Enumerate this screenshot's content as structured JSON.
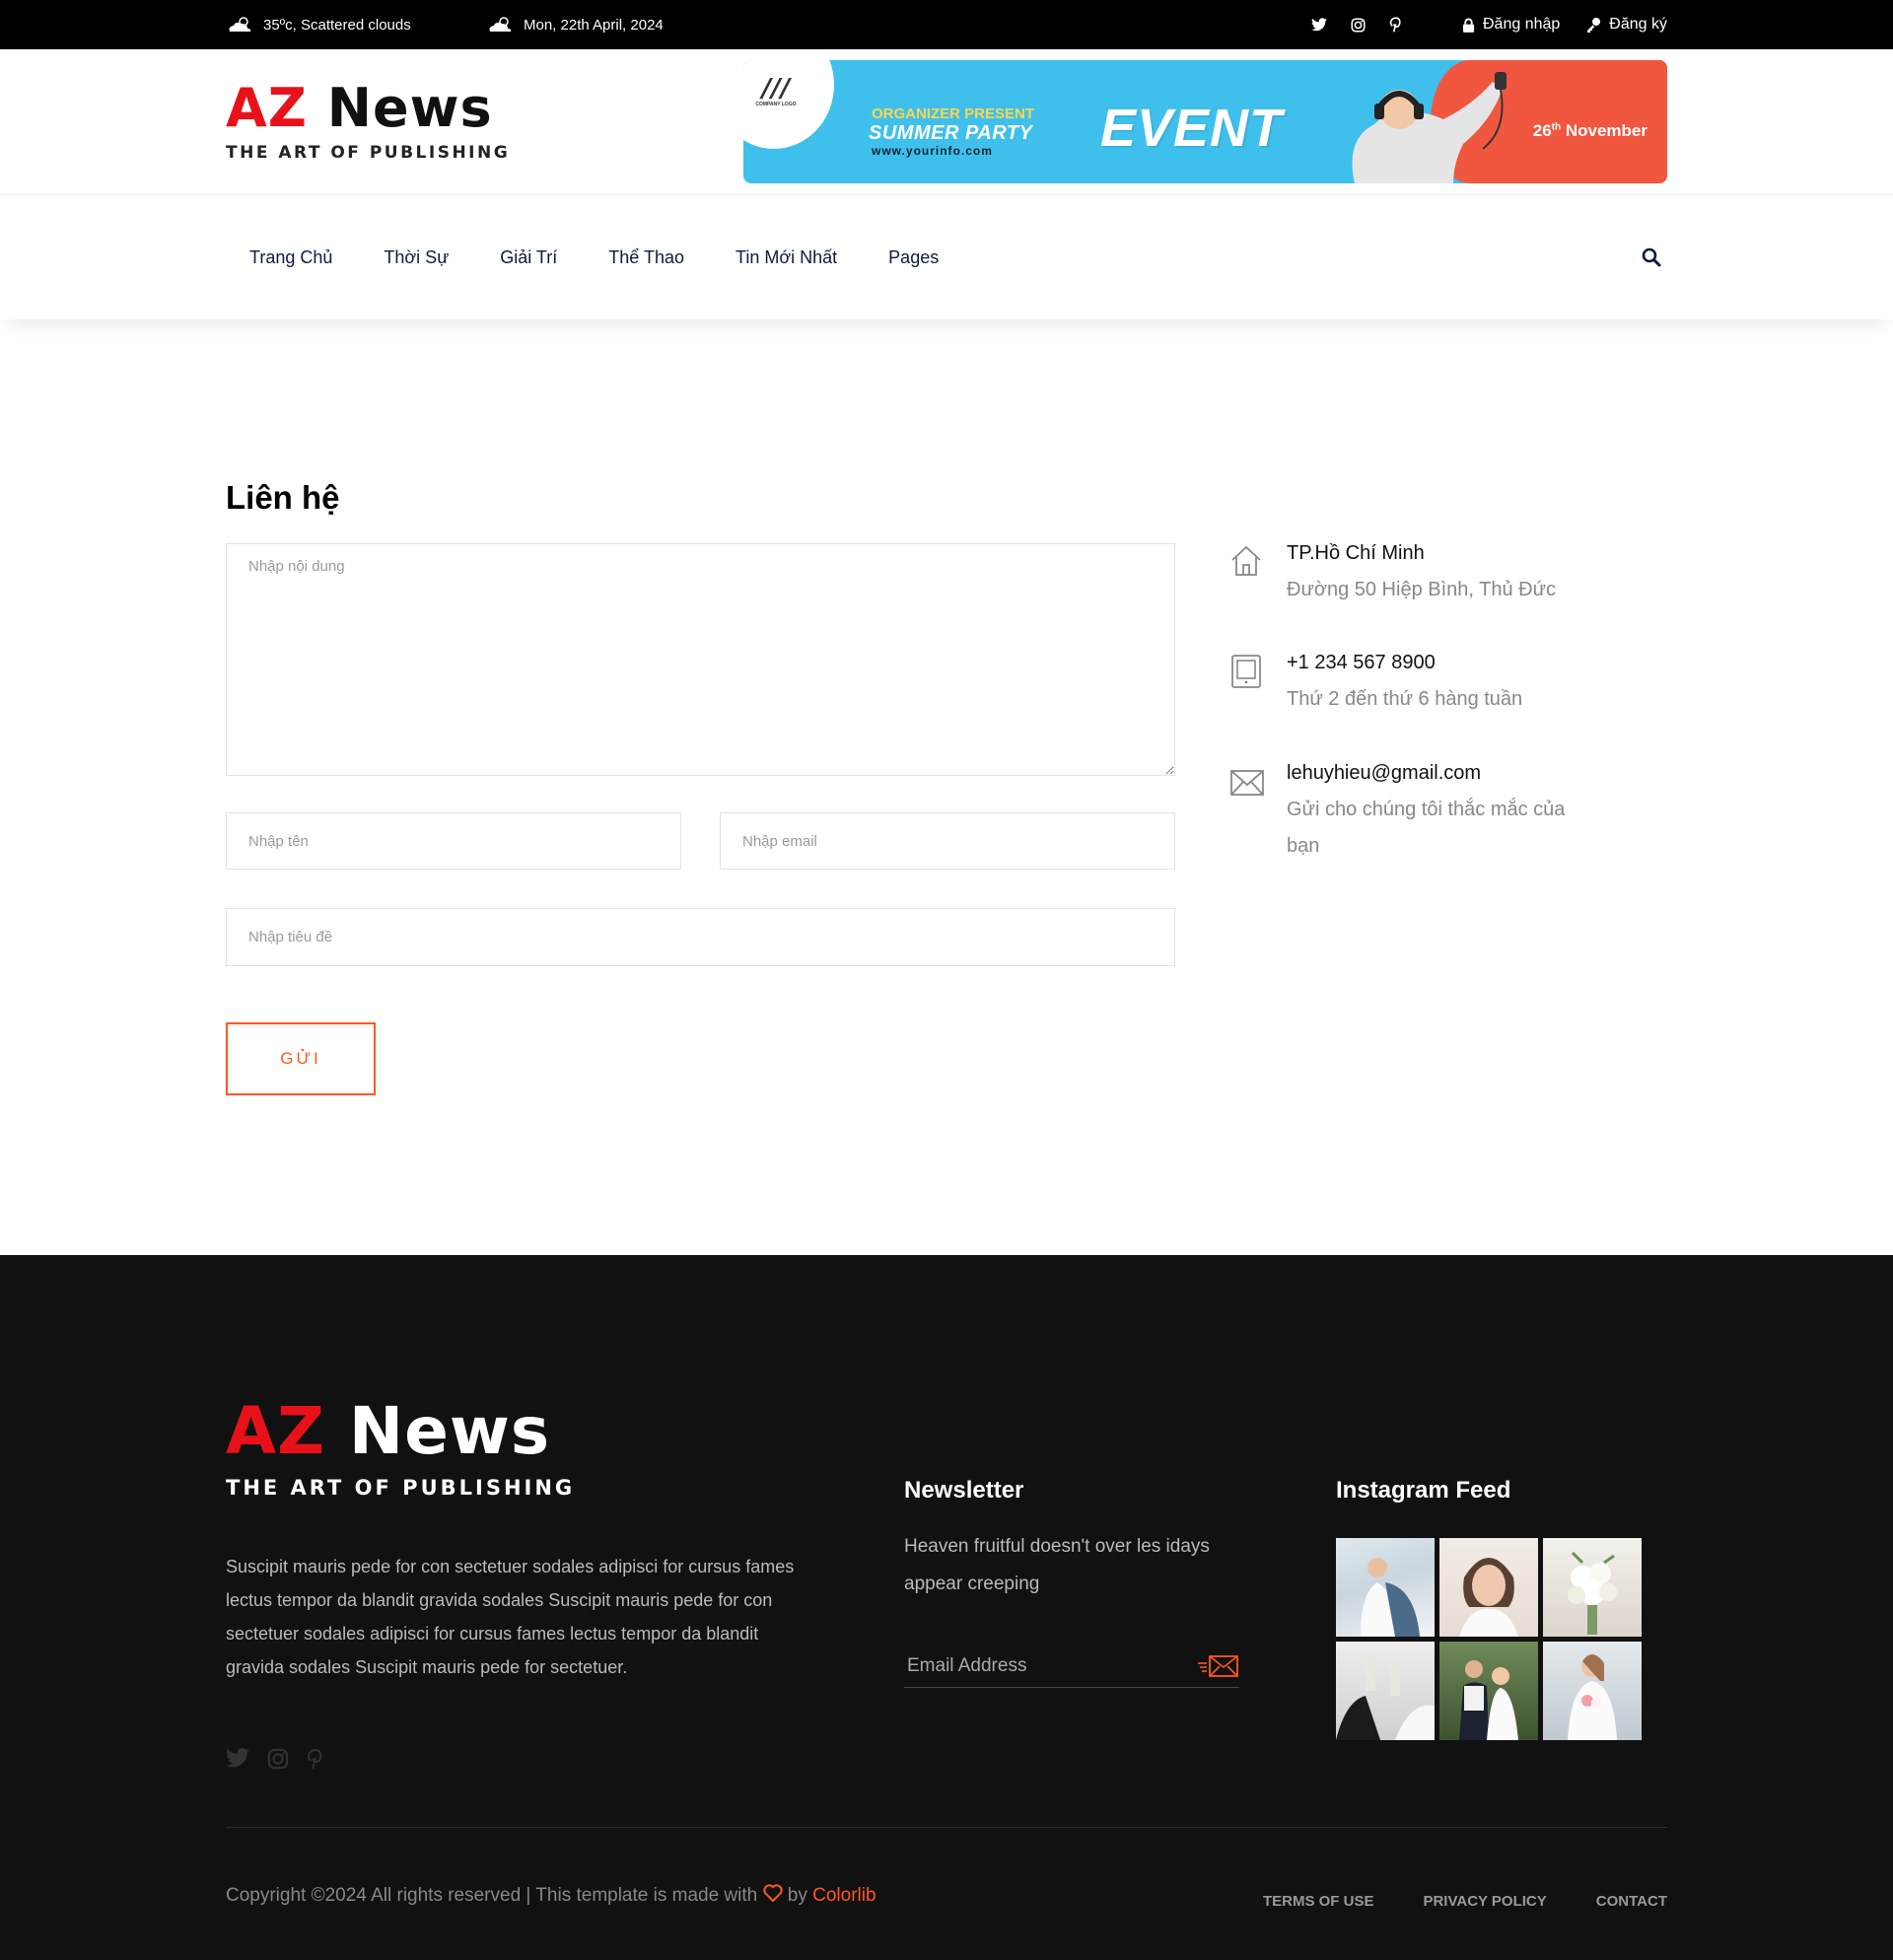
{
  "topbar": {
    "weather": "35ºc, Scattered clouds",
    "date": "Mon, 22th April, 2024",
    "social_icons": [
      "twitter-icon",
      "instagram-icon",
      "pinterest-icon"
    ],
    "login_label": "Đăng nhập",
    "register_label": "Đăng ký"
  },
  "logo": {
    "az": "AZ",
    "news": "News",
    "tagline": "THE ART OF PUBLISHING"
  },
  "banner": {
    "company": "COMPANY LOGO",
    "organizer": "ORGANIZER PRESENT",
    "party": "SUMMER PARTY",
    "url": "www.yourinfo.com",
    "event": "EVENT",
    "date_day": "26",
    "date_sup": "th",
    "date_month": "November",
    "colors": {
      "blue": "#3fc0ec",
      "red": "#f1573f"
    }
  },
  "nav": {
    "items": [
      "Trang Chủ",
      "Thời Sự",
      "Giải Trí",
      "Thể Thao",
      "Tin Mới Nhất",
      "Pages"
    ]
  },
  "contact": {
    "title": "Liên hệ",
    "message_placeholder": "Nhập nội dung",
    "name_placeholder": "Nhập tên",
    "email_placeholder": "Nhập email",
    "subject_placeholder": "Nhập tiêu đề",
    "send_label": "GỬI",
    "info": [
      {
        "icon": "home-icon",
        "title": "TP.Hồ Chí Minh",
        "desc": "Đường 50 Hiệp Bình, Thủ Đức"
      },
      {
        "icon": "tablet-icon",
        "title": "+1 234 567 8900",
        "desc": "Thứ 2 đến thứ 6 hàng tuần"
      },
      {
        "icon": "mail-icon",
        "title": "lehuyhieu@gmail.com",
        "desc": "Gửi cho chúng tôi thắc mắc của bạn"
      }
    ]
  },
  "footer": {
    "about": "Suscipit mauris pede for con sectetuer sodales adipisci for cursus fames lectus tempor da blandit gravida sodales Suscipit mauris pede for con sectetuer sodales adipisci for cursus fames lectus tempor da blandit gravida sodales Suscipit mauris pede for sectetuer.",
    "newsletter_title": "Newsletter",
    "newsletter_text": "Heaven fruitful doesn't over les idays appear creeping",
    "email_placeholder": "Email Address",
    "instagram_title": "Instagram Feed",
    "copyright_prefix": "Copyright ©2024 All rights reserved | This template is made with",
    "copyright_by": "by",
    "copyright_brand": "Colorlib",
    "links": [
      "TERMS OF USE",
      "PRIVACY POLICY",
      "CONTACT"
    ],
    "accent": "#ff5722"
  }
}
